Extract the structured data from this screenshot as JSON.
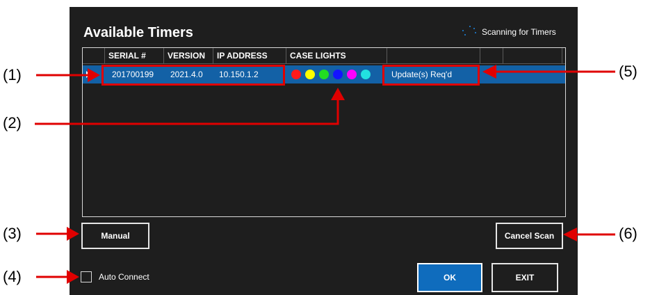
{
  "dialog": {
    "title": "Available Timers",
    "scanning_label": "Scanning for Timers"
  },
  "table": {
    "columns": [
      "SERIAL #",
      "VERSION",
      "IP ADDRESS",
      "CASE LIGHTS"
    ],
    "rows": [
      {
        "serial": "201700199",
        "version": "2021.4.0",
        "ip": "10.150.1.2",
        "case_lights": [
          "#ff1a1a",
          "#ffff00",
          "#22dd22",
          "#1414ff",
          "#ff00ff",
          "#22e0e0"
        ],
        "status": "Update(s) Req'd"
      }
    ]
  },
  "buttons": {
    "manual": "Manual",
    "cancel_scan": "Cancel Scan",
    "ok": "OK",
    "exit": "EXIT"
  },
  "auto_connect": {
    "label": "Auto Connect",
    "checked": false
  },
  "callouts": [
    "(1)",
    "(2)",
    "(3)",
    "(4)",
    "(5)",
    "(6)"
  ],
  "colors": {
    "background": "#1e1e1e",
    "selection": "#1361a6",
    "primary_button": "#0f6cbd",
    "annotation": "#e00000"
  }
}
